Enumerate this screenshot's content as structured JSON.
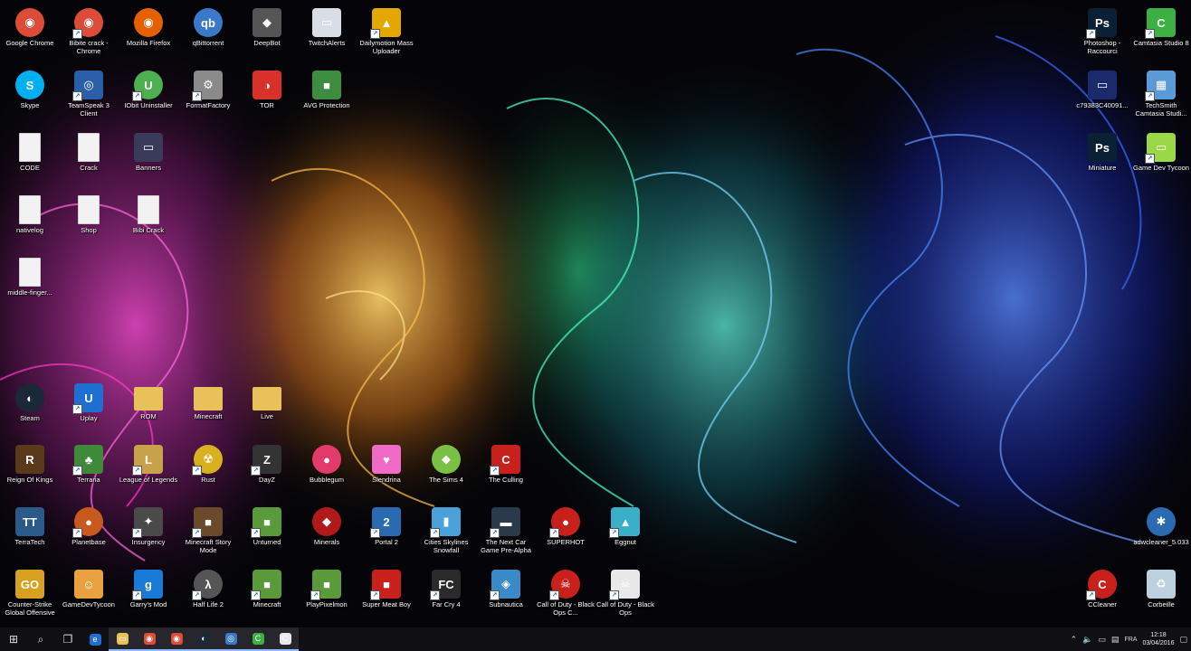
{
  "desktop": {
    "icons": [
      {
        "label": "Google Chrome",
        "glyph": "◉",
        "bg": "#dd4b39",
        "shape": "round"
      },
      {
        "label": "Bibite crack - Chrome",
        "glyph": "◉",
        "bg": "#dd4b39",
        "shape": "round",
        "shortcut": true
      },
      {
        "label": "Mozilla Firefox",
        "glyph": "◉",
        "bg": "#e66000",
        "shape": "round"
      },
      {
        "label": "qBittorrent",
        "glyph": "qb",
        "bg": "#3a78c8",
        "shape": "round"
      },
      {
        "label": "DeepBot",
        "glyph": "◆",
        "bg": "#555555"
      },
      {
        "label": "TwitchAlerts",
        "glyph": "▭",
        "bg": "#d8dde6"
      },
      {
        "label": "Dailymotion Mass Uploader",
        "glyph": "▲",
        "bg": "#e2a800",
        "shortcut": true
      },
      {
        "label": "Skype",
        "glyph": "S",
        "bg": "#00aff0",
        "shape": "round"
      },
      {
        "label": "TeamSpeak 3 Client",
        "glyph": "◎",
        "bg": "#2b5ea8",
        "shortcut": true
      },
      {
        "label": "IObit Uninstaller",
        "glyph": "U",
        "bg": "#4caf50",
        "shape": "round",
        "shortcut": true
      },
      {
        "label": "FormatFactory",
        "glyph": "⚙",
        "bg": "#8a8a8a",
        "shortcut": true
      },
      {
        "label": "TOR",
        "glyph": "◑",
        "bg": "#d8312b"
      },
      {
        "label": "AVG Protection",
        "glyph": "■",
        "bg": "#3d8c40"
      },
      {
        "label": "CODE",
        "glyph": "",
        "shape": "doc"
      },
      {
        "label": "Crack",
        "glyph": "",
        "shape": "doc"
      },
      {
        "label": "Banners",
        "glyph": "▭",
        "bg": "#3a3a5a"
      },
      {
        "label": "nativelog",
        "glyph": "",
        "shape": "doc"
      },
      {
        "label": "Shop",
        "glyph": "",
        "shape": "doc"
      },
      {
        "label": "Bibi Crack",
        "glyph": "",
        "shape": "doc"
      },
      {
        "label": "middle-finger...",
        "glyph": "",
        "shape": "doc"
      },
      {
        "label": "Steam",
        "glyph": "◐",
        "bg": "#1b2838",
        "shape": "round"
      },
      {
        "label": "Uplay",
        "glyph": "U",
        "bg": "#1f6fd0",
        "shortcut": true
      },
      {
        "label": "ROM",
        "glyph": "",
        "shape": "folder"
      },
      {
        "label": "Minecraft",
        "glyph": "",
        "shape": "folder"
      },
      {
        "label": "Live",
        "glyph": "",
        "shape": "folder"
      },
      {
        "label": "Reign Of Kings",
        "glyph": "R",
        "bg": "#5a3a1a"
      },
      {
        "label": "Terraria",
        "glyph": "♣",
        "bg": "#3f8a3a",
        "shortcut": true
      },
      {
        "label": "League of Legends",
        "glyph": "L",
        "bg": "#c8a24a",
        "shortcut": true
      },
      {
        "label": "Rust",
        "glyph": "☢",
        "bg": "#d8b020",
        "shape": "round",
        "shortcut": true
      },
      {
        "label": "DayZ",
        "glyph": "Z",
        "bg": "#333333",
        "shortcut": true
      },
      {
        "label": "Bubblegum",
        "glyph": "●",
        "bg": "#e23a6a",
        "shape": "round"
      },
      {
        "label": "Slendrina",
        "glyph": "♥",
        "bg": "#f06ac8"
      },
      {
        "label": "The Sims 4",
        "glyph": "◆",
        "bg": "#7ac143",
        "shape": "round"
      },
      {
        "label": "The Culling",
        "glyph": "C",
        "bg": "#c8201a",
        "shortcut": true
      },
      {
        "label": "TerraTech",
        "glyph": "TT",
        "bg": "#2a5a8a"
      },
      {
        "label": "Planetbase",
        "glyph": "●",
        "bg": "#c85a20",
        "shape": "round",
        "shortcut": true
      },
      {
        "label": "Insurgency",
        "glyph": "✦",
        "bg": "#4a4a4a",
        "shortcut": true
      },
      {
        "label": "Minecraft Story Mode",
        "glyph": "■",
        "bg": "#6a4a2a",
        "shortcut": true
      },
      {
        "label": "Unturned",
        "glyph": "■",
        "bg": "#5a9a3a",
        "shortcut": true
      },
      {
        "label": "Minerals",
        "glyph": "◆",
        "bg": "#b01a1a",
        "shape": "round"
      },
      {
        "label": "Portal 2",
        "glyph": "2",
        "bg": "#2a6ab0",
        "shortcut": true
      },
      {
        "label": "Cities Skylines Snowfall",
        "glyph": "▮",
        "bg": "#4aa0d8",
        "shortcut": true
      },
      {
        "label": "The Next Car Game Pre-Alpha",
        "glyph": "▬",
        "bg": "#2a3a4a",
        "shortcut": true
      },
      {
        "label": "SUPERHOT",
        "glyph": "●",
        "bg": "#c8201a",
        "shape": "round",
        "shortcut": true
      },
      {
        "label": "Eggnut",
        "glyph": "▲",
        "bg": "#3ab0c8",
        "shortcut": true
      },
      {
        "label": "Counter-Strike Global Offensive",
        "glyph": "GO",
        "bg": "#d8a020"
      },
      {
        "label": "GameDevTycoon",
        "glyph": "☺",
        "bg": "#e8a040"
      },
      {
        "label": "Garry's Mod",
        "glyph": "g",
        "bg": "#1a7ad8",
        "shortcut": true
      },
      {
        "label": "Half Life 2",
        "glyph": "λ",
        "bg": "#555555",
        "shape": "round",
        "shortcut": true
      },
      {
        "label": "Minecraft",
        "glyph": "■",
        "bg": "#5a9a3a",
        "shortcut": true
      },
      {
        "label": "PlayPixelmon",
        "glyph": "■",
        "bg": "#5a9a3a",
        "shortcut": true
      },
      {
        "label": "Super Meat Boy",
        "glyph": "■",
        "bg": "#c8201a",
        "shortcut": true
      },
      {
        "label": "Far Cry 4",
        "glyph": "FC",
        "bg": "#2a2a2a",
        "shortcut": true
      },
      {
        "label": "Subnautica",
        "glyph": "◈",
        "bg": "#3a8ac8",
        "shortcut": true
      },
      {
        "label": "Call of Duty - Black Ops C...",
        "glyph": "☠",
        "bg": "#c8201a",
        "shape": "round",
        "shortcut": true
      },
      {
        "label": "Call of Duty - Black Ops",
        "glyph": "☠",
        "bg": "#e8e8e8",
        "shortcut": true
      },
      {
        "label": "Photoshop - Raccourci",
        "glyph": "Ps",
        "bg": "#0b1f35",
        "shortcut": true
      },
      {
        "label": "Camtasia Studio 8",
        "glyph": "C",
        "bg": "#3cb043",
        "shortcut": true
      },
      {
        "label": "c79383C40091...",
        "glyph": "▭",
        "bg": "#1a2a6a"
      },
      {
        "label": "TechSmith Camtasia Studi...",
        "glyph": "▦",
        "bg": "#5a9ad8",
        "shortcut": true
      },
      {
        "label": "Miniature",
        "glyph": "Ps",
        "bg": "#0b1f35"
      },
      {
        "label": "Game Dev Tycoon",
        "glyph": "▭",
        "bg": "#9ad848",
        "shortcut": true
      },
      {
        "label": "adwcleaner_5.033",
        "glyph": "✱",
        "bg": "#2a6ab0",
        "shape": "round"
      },
      {
        "label": "CCleaner",
        "glyph": "C",
        "bg": "#c8201a",
        "shape": "round",
        "shortcut": true
      },
      {
        "label": "Corbeille",
        "glyph": "♻",
        "bg": "#bcd0e0"
      }
    ]
  },
  "taskbar": {
    "start_glyph": "⊞",
    "search_glyph": "⌕",
    "taskview_glyph": "❐",
    "apps": [
      {
        "name": "edge",
        "glyph": "e",
        "bg": "#1e6fd0"
      },
      {
        "name": "file-explorer",
        "glyph": "▭",
        "bg": "#e8c15a"
      },
      {
        "name": "chrome",
        "glyph": "◉",
        "bg": "#dd4b39"
      },
      {
        "name": "chrome-2",
        "glyph": "◉",
        "bg": "#dd4b39"
      },
      {
        "name": "steam",
        "glyph": "◐",
        "bg": "#1b2838"
      },
      {
        "name": "app-blue",
        "glyph": "◎",
        "bg": "#3a78c8"
      },
      {
        "name": "camtasia-recorder",
        "glyph": "C",
        "bg": "#3cb043"
      },
      {
        "name": "camtasia",
        "glyph": "C",
        "bg": "#e8e8e8"
      }
    ],
    "tray": {
      "language": "FRA",
      "time": "12:18",
      "date": "03/04/2016"
    }
  }
}
